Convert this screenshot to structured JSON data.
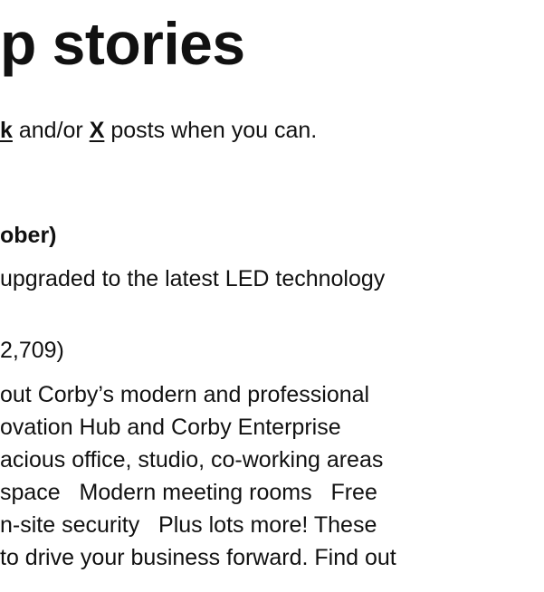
{
  "header": {
    "title_tail": "p stories"
  },
  "intro": {
    "before": "",
    "link1": "k",
    "middle": " and/or ",
    "link2": "X",
    "after": " posts when you can."
  },
  "story": {
    "heading": "ober)",
    "summary": "upgraded to the latest LED technology",
    "meta": "2,709)",
    "body_lines": [
      "out Corby’s modern and professional",
      "ovation Hub and Corby Enterprise",
      "acious office, studio, co-working areas",
      "space   Modern meeting rooms   Free",
      "n-site security   Plus lots more! These",
      "to drive your business forward. Find out"
    ]
  }
}
